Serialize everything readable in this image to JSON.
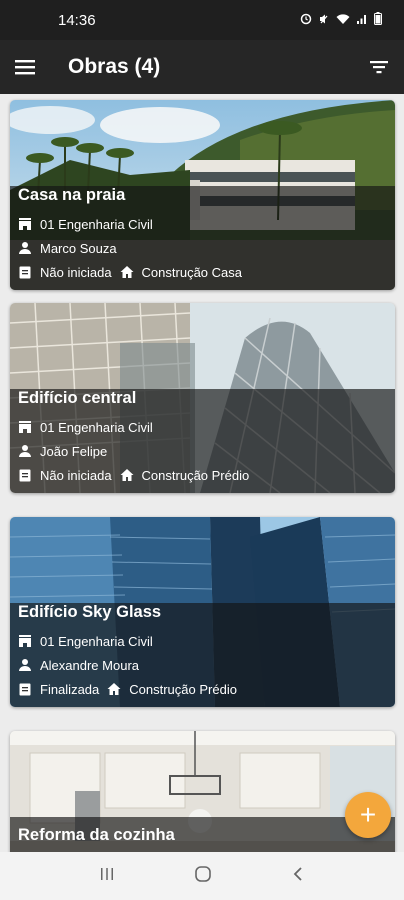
{
  "status": {
    "time": "14:36"
  },
  "app_bar": {
    "title": "Obras (4)"
  },
  "cards": [
    {
      "name": "Casa na praia",
      "company": "01 Engenharia Civil",
      "responsible": "Marco Souza",
      "status": "Não iniciada",
      "type": "Construção Casa"
    },
    {
      "name": "Edifício central",
      "company": "01 Engenharia Civil",
      "responsible": "João Felipe",
      "status": "Não iniciada",
      "type": "Construção Prédio"
    },
    {
      "name": "Edifício Sky Glass",
      "company": "01 Engenharia Civil",
      "responsible": "Alexandre Moura",
      "status": "Finalizada",
      "type": "Construção Prédio"
    },
    {
      "name": "Reforma da cozinha"
    }
  ],
  "fab": {
    "label": "+",
    "color": "#f3a73c"
  },
  "icons": [
    "menu-icon",
    "filter-icon",
    "company-icon",
    "person-icon",
    "clipboard-icon",
    "home-icon",
    "add-icon",
    "recents-icon",
    "home-nav-icon",
    "back-icon"
  ]
}
